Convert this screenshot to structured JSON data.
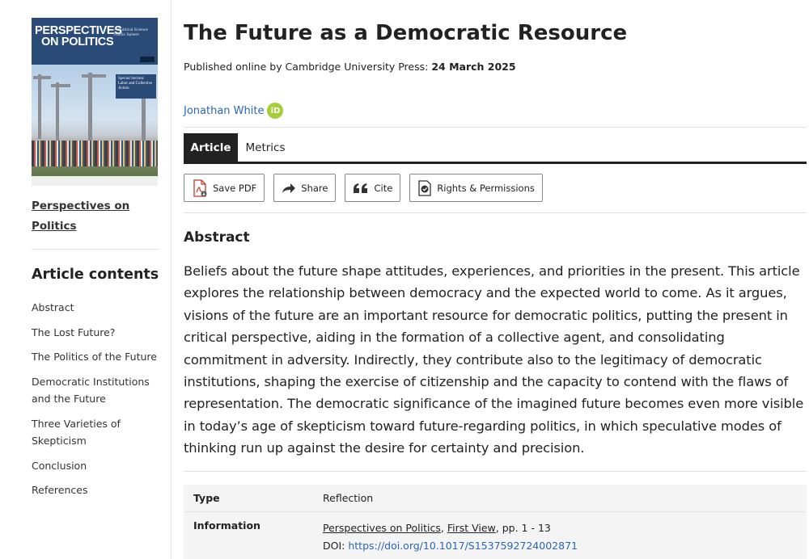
{
  "sidebar": {
    "cover": {
      "title_line1": "PERSPECTIVES",
      "title_line2": "ON POLITICS",
      "subtitle": "A Political Science Public Sphere",
      "special_box": "Special Section: Labor and Collective Action"
    },
    "journal_link": "Perspectives on Politics",
    "contents_heading": "Article contents",
    "toc": [
      "Abstract",
      "The Lost Future?",
      "The Politics of the Future",
      "Democratic Institutions and the Future",
      "Three Varieties of Skepticism",
      "Conclusion",
      "References"
    ]
  },
  "article": {
    "title": "The Future as a Democratic Resource",
    "published_prefix": "Published online by Cambridge University Press:",
    "published_date": "24 March 2025",
    "author": "Jonathan White",
    "orcid_label": "iD",
    "tabs": [
      "Article",
      "Metrics"
    ],
    "actions": {
      "save_pdf": "Save PDF",
      "share": "Share",
      "cite": "Cite",
      "rights": "Rights & Permissions"
    },
    "abstract_heading": "Abstract",
    "abstract_text": "Beliefs about the future shape attitudes, experiences, and priorities in the present. This article explores the relationship between democracy and the expected world to come. As it argues, visions of the future are an important resource for democratic politics, putting the present in critical perspective, aiding in the formation of a collective agent, and consolidating commitment in adversity. Indirectly, they contribute also to the legitimacy of democratic institutions, shaping the exercise of citizenship and the capacity to contend with the flaws of representation. The democratic significance of the imagined future becomes even more visible in today’s age of skepticism toward future-regarding politics, in which speculative modes of thinking run up against the desire for certainty and precision.",
    "meta": {
      "type_label": "Type",
      "type_value": "Reflection",
      "info_label": "Information",
      "info_journal": "Perspectives on Politics",
      "info_sep1": ", ",
      "info_view": "First View",
      "info_pages": ", pp. 1 - 13",
      "doi_prefix": "DOI: ",
      "doi_link": "https://doi.org/10.1017/S1537592724002871"
    }
  },
  "colors": {
    "link_blue": "#2966b8",
    "orcid_green": "#a6ce39",
    "cover_band": "#2a4a78",
    "tab_active": "#222222"
  }
}
